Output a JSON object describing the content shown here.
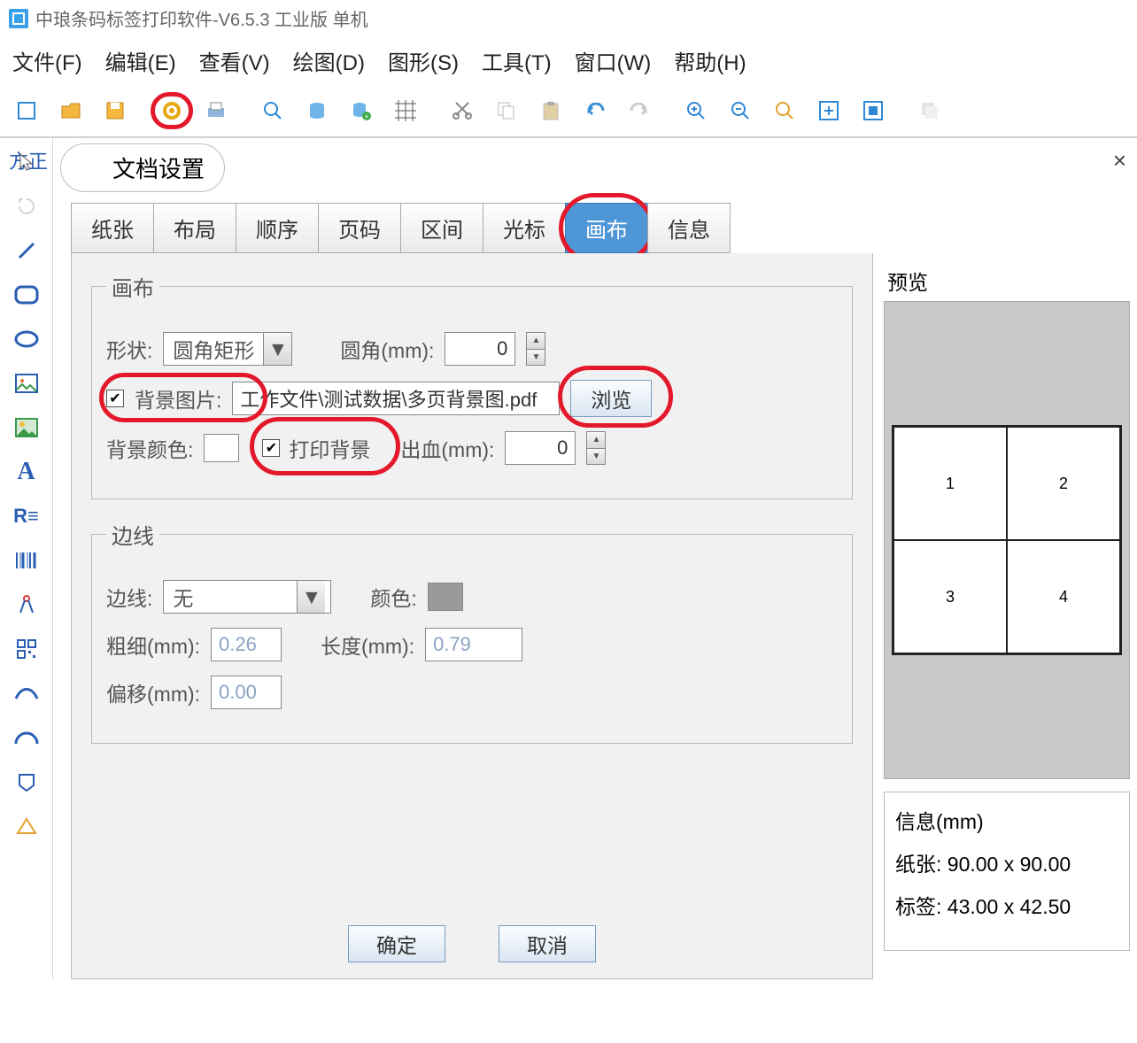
{
  "app": {
    "title": "中琅条码标签打印软件-V6.5.3 工业版 单机"
  },
  "menus": {
    "file": "文件(F)",
    "edit": "编辑(E)",
    "view": "查看(V)",
    "draw": "绘图(D)",
    "shape": "图形(S)",
    "tool": "工具(T)",
    "window": "窗口(W)",
    "help": "帮助(H)"
  },
  "hidden_font": "方正",
  "dialog": {
    "title": "文档设置"
  },
  "tabs": {
    "paper": "纸张",
    "layout": "布局",
    "order": "顺序",
    "pageno": "页码",
    "range": "区间",
    "cursor": "光标",
    "canvas": "画布",
    "info": "信息"
  },
  "canvas": {
    "legend": "画布",
    "shape_label": "形状:",
    "shape_value": "圆角矩形",
    "radius_label": "圆角(mm):",
    "radius_value": "0",
    "bgimg_label": "背景图片:",
    "bgimg_value": "工作文件\\测试数据\\多页背景图.pdf",
    "browse": "浏览",
    "bgcolor_label": "背景颜色:",
    "printbg_label": "打印背景",
    "bleed_label": "出血(mm):",
    "bleed_value": "0"
  },
  "border": {
    "legend": "边线",
    "border_label": "边线:",
    "border_value": "无",
    "color_label": "颜色:",
    "thick_label": "粗细(mm):",
    "thick_value": "0.26",
    "len_label": "长度(mm):",
    "len_value": "0.79",
    "offset_label": "偏移(mm):",
    "offset_value": "0.00"
  },
  "footer": {
    "ok": "确定",
    "cancel": "取消"
  },
  "preview": {
    "title": "预览",
    "cells": [
      "1",
      "2",
      "3",
      "4"
    ],
    "info_title": "信息(mm)",
    "paper_label": "纸张:",
    "paper_value": "90.00 x 90.00",
    "label_label": "标签:",
    "label_value": "43.00 x 42.50"
  }
}
